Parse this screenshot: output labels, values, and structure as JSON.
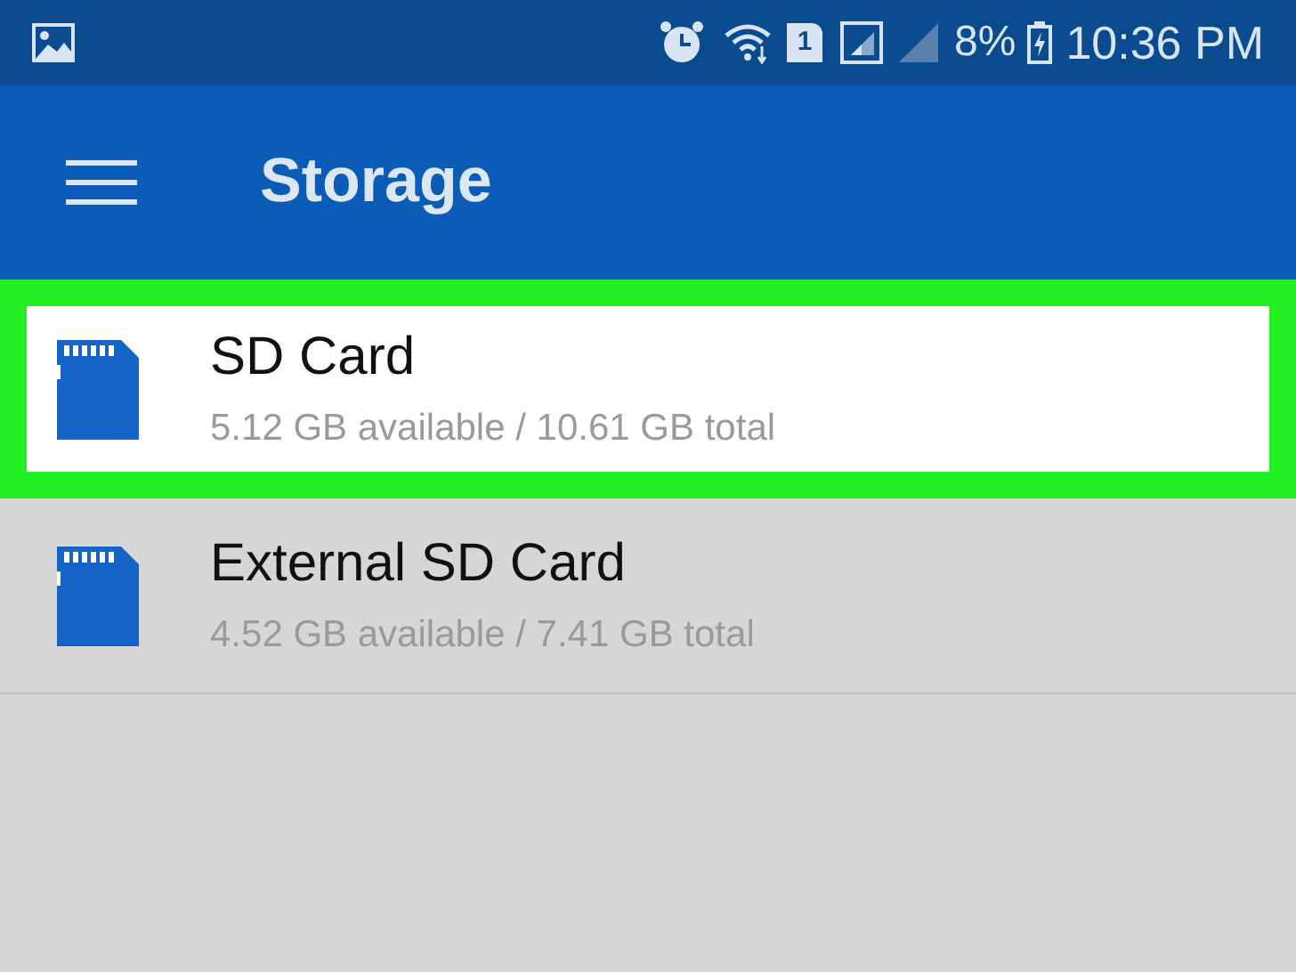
{
  "status_bar": {
    "sim_slot": "1",
    "battery": "8%",
    "time": "10:36 PM"
  },
  "app_bar": {
    "title": "Storage"
  },
  "storage_items": [
    {
      "name": "SD Card",
      "detail": "5.12 GB available / 10.61 GB total",
      "selected": true
    },
    {
      "name": "External SD Card",
      "detail": "4.52 GB available / 7.41 GB total",
      "selected": false
    }
  ]
}
